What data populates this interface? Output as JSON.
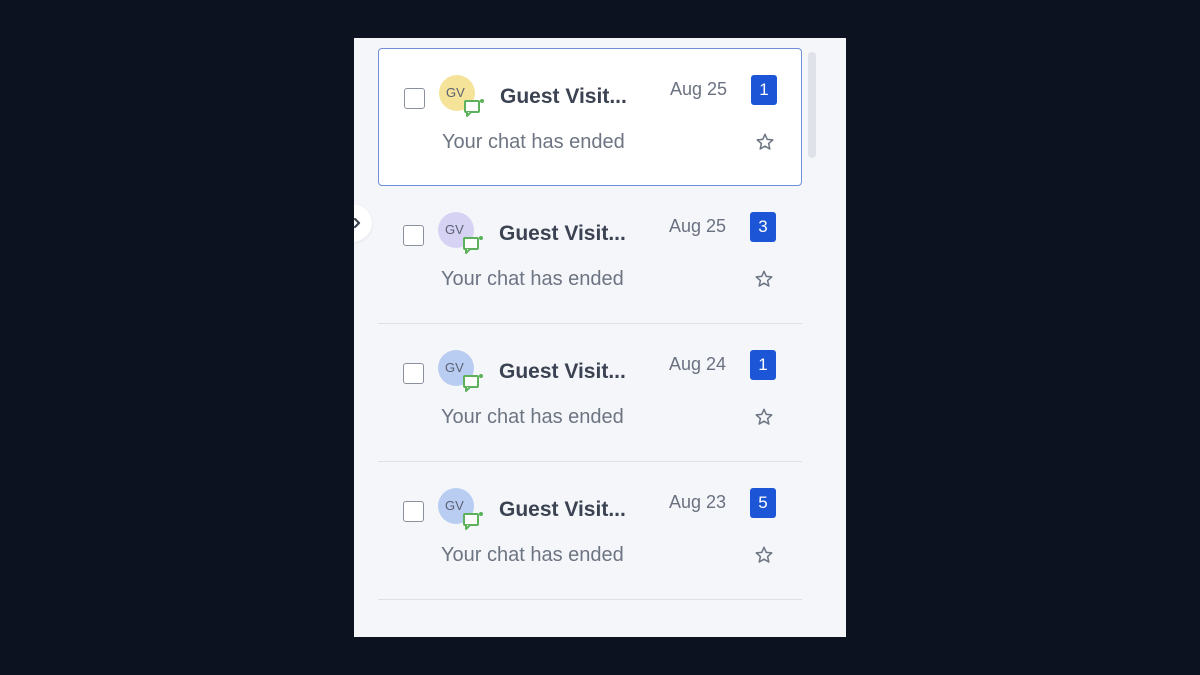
{
  "colors": {
    "background": "#0c1220",
    "panel": "#f4f6fa",
    "selected_border": "#6f8fd8",
    "badge": "#1c56d6",
    "chat_icon": "#5cb15a"
  },
  "conversations": [
    {
      "initials": "GV",
      "name": "Guest Visit...",
      "date": "Aug 25",
      "unread": "1",
      "preview": "Your chat has ended",
      "avatar_color": "#f5e39a",
      "selected": true
    },
    {
      "initials": "GV",
      "name": "Guest Visit...",
      "date": "Aug 25",
      "unread": "3",
      "preview": "Your chat has ended",
      "avatar_color": "#d6d2f4",
      "selected": false
    },
    {
      "initials": "GV",
      "name": "Guest Visit...",
      "date": "Aug 24",
      "unread": "1",
      "preview": "Your chat has ended",
      "avatar_color": "#b9cdf2",
      "selected": false
    },
    {
      "initials": "GV",
      "name": "Guest Visit...",
      "date": "Aug 23",
      "unread": "5",
      "preview": "Your chat has ended",
      "avatar_color": "#b9cdf2",
      "selected": false
    }
  ],
  "icons": {
    "channel": "chat-bubble-icon",
    "favorite": "star-outline-icon",
    "collapse": "chevron-right-icon"
  }
}
